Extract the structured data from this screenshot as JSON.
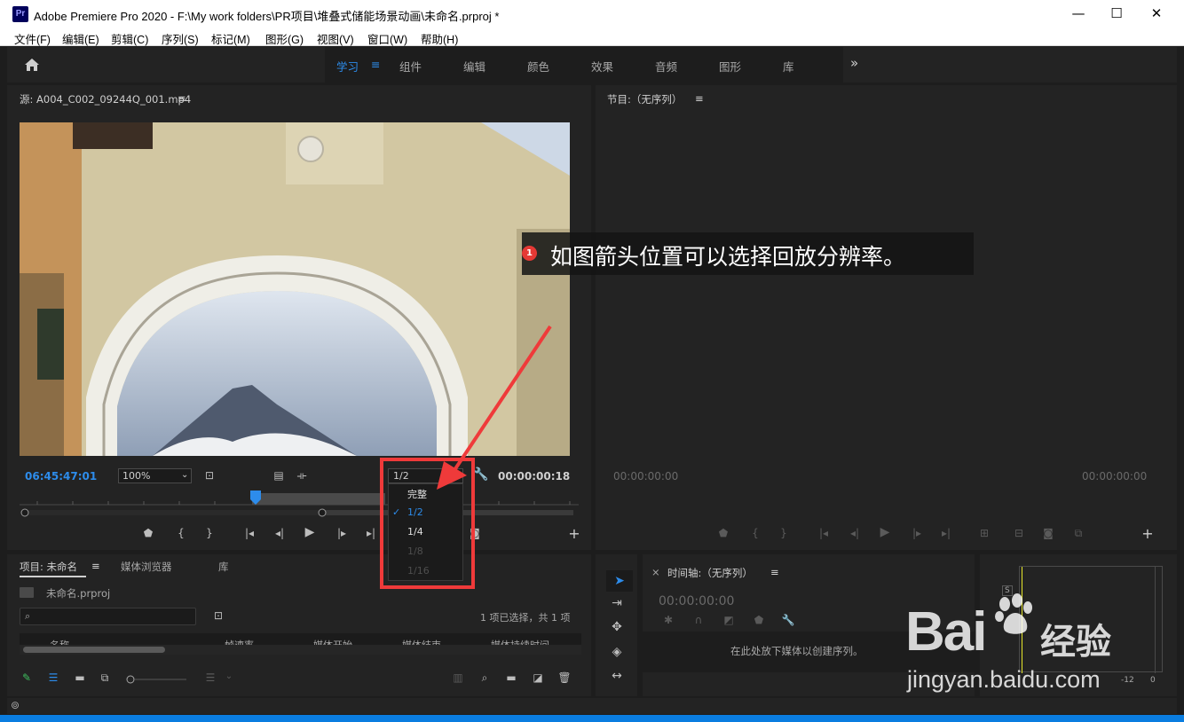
{
  "window": {
    "app_icon_label": "Pr",
    "title": "Adobe Premiere Pro 2020 - F:\\My work folders\\PR项目\\堆叠式储能场景动画\\未命名.prproj *",
    "minimize": "—",
    "maximize": "☐",
    "close": "✕"
  },
  "menubar": {
    "items": [
      "文件(F)",
      "编辑(E)",
      "剪辑(C)",
      "序列(S)",
      "标记(M)",
      "图形(G)",
      "视图(V)",
      "窗口(W)",
      "帮助(H)"
    ]
  },
  "workspaces": {
    "items": [
      "学习",
      "组件",
      "编辑",
      "颜色",
      "效果",
      "音频",
      "图形",
      "库"
    ],
    "active": "学习",
    "menu_glyph": "≡",
    "overflow": "»"
  },
  "source_monitor": {
    "title": "源: A004_C002_09244Q_001.mp4",
    "menu_glyph": "≡",
    "timecode_current": "06:45:47:01",
    "zoom": "100%",
    "resolution": "1/2",
    "timecode_duration": "00:00:00:18"
  },
  "resolution_menu": {
    "options": [
      {
        "label": "完整",
        "checked": false,
        "enabled": true
      },
      {
        "label": "1/2",
        "checked": true,
        "enabled": true
      },
      {
        "label": "1/4",
        "checked": false,
        "enabled": true
      },
      {
        "label": "1/8",
        "checked": false,
        "enabled": false
      },
      {
        "label": "1/16",
        "checked": false,
        "enabled": false
      }
    ],
    "check_glyph": "✓"
  },
  "program_monitor": {
    "title": "节目:（无序列）",
    "menu_glyph": "≡",
    "timecode_left": "00:00:00:00",
    "timecode_right": "00:00:00:00"
  },
  "project_panel": {
    "tabs": [
      "项目: 未命名",
      "媒体浏览器",
      "库"
    ],
    "menu_glyph": "≡",
    "file_name": "未命名.prproj",
    "selection_status": "1 项已选择，共 1 项",
    "columns": [
      "名称",
      "帧速率",
      "媒体开始",
      "媒体结束",
      "媒体持续时间"
    ]
  },
  "timeline_panel": {
    "close_glyph": "×",
    "title": "时间轴:（无序列）",
    "menu_glyph": "≡",
    "timecode": "00:00:00:00",
    "empty_message": "在此处放下媒体以创建序列。"
  },
  "audio_meter": {
    "solo_label": "S",
    "scale_labels": [
      "-12",
      "0"
    ]
  },
  "annotation": {
    "step": "1",
    "text": "如图箭头位置可以选择回放分辨率。",
    "color": "#ef3a3a"
  },
  "watermark": {
    "brand": "Bai",
    "product": "经验",
    "url": "jingyan.baidu.com"
  },
  "colors": {
    "accent": "#2d8ceb",
    "panel": "#232323",
    "background": "#1d1d1d",
    "annotation_red": "#ef3a3a"
  }
}
